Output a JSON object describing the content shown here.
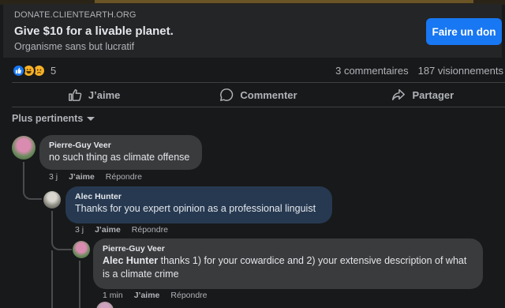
{
  "ad": {
    "domain": "DONATE.CLIENTEARTH.ORG",
    "title": "Give $10 for a livable planet.",
    "subtitle": "Organisme sans but lucratif",
    "cta": "Faire un don",
    "accent": "#1877f2"
  },
  "post_stats": {
    "reaction_icons": [
      "like-icon",
      "haha-icon",
      "sad-icon"
    ],
    "reaction_count": "5",
    "comments": "3 commentaires",
    "views": "187 visionnements"
  },
  "actions": {
    "like": "J’aime",
    "comment": "Commenter",
    "share": "Partager"
  },
  "sort_label": "Plus pertinents",
  "comments": [
    {
      "author": "Pierre-Guy Veer",
      "text": "no such thing as climate offense",
      "time": "3 j",
      "like": "J’aime",
      "reply": "Répondre"
    },
    {
      "author": "Alec Hunter",
      "text": "Thanks for you expert opinion as a professional linguist",
      "time": "3 j",
      "like": "J’aime",
      "reply": "Répondre",
      "highlight": true
    },
    {
      "author": "Pierre-Guy Veer",
      "mention": "Alec Hunter",
      "text": " thanks 1) for your cowardice and 2) your extensive description of what is a climate crime",
      "time": "1 min",
      "like": "J’aime",
      "reply": "Répondre"
    }
  ]
}
